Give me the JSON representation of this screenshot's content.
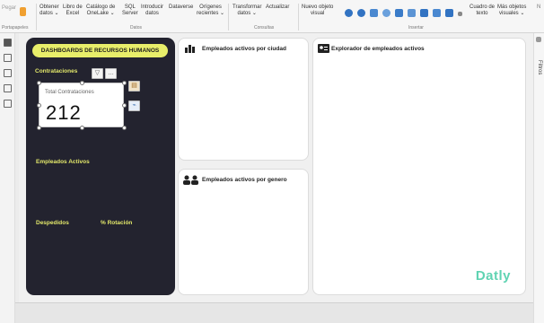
{
  "ribbon": {
    "portapapeles": "Portapapeles",
    "pegar": "Pegar",
    "datos_group": "Datos",
    "consultas_group": "Consultas",
    "insertar_group": "Insertar",
    "btn_obtener": "Obtener\ndatos ⌄",
    "btn_libro": "Libro de\nExcel",
    "btn_catalogo": "Catálogo de\nOneLake ⌄",
    "btn_sql": "SQL\nServer",
    "btn_introducir": "Introducir\ndatos",
    "btn_dataverse": "Dataverse",
    "btn_origenes": "Orígenes\nrecientes ⌄",
    "btn_transformar": "Transformar\ndatos ⌄",
    "btn_actualizar": "Actualizar",
    "btn_nuevo_objeto": "Nuevo objeto\nvisual",
    "btn_cuadro": "Cuadro de\ntexto",
    "btn_mas_objetos": "Más objetos\nvisuales ⌄"
  },
  "dashboard": {
    "title": "DASHBOARDS DE RECURSOS HUMANOS",
    "contrataciones": "Contrataciones",
    "kpi_title": "Total Contrataciones",
    "kpi_value": "212",
    "empleados_activos": "Empleados Activos",
    "despedidos": "Despedidos",
    "rotacion": "% Rotación"
  },
  "cards": {
    "ciudad": "Empleados activos por ciudad",
    "genero": "Empleados activos por genero",
    "explorador": "Explorador de empleados activos"
  },
  "logo": "Datly",
  "filtros": "Filtros",
  "icons": [
    "clipboard-icon",
    "pin-icon",
    "database-icon",
    "bar-chart-icon",
    "people-icon",
    "id-card-icon",
    "filter-icon",
    "more-icon",
    "chevron-icon"
  ]
}
